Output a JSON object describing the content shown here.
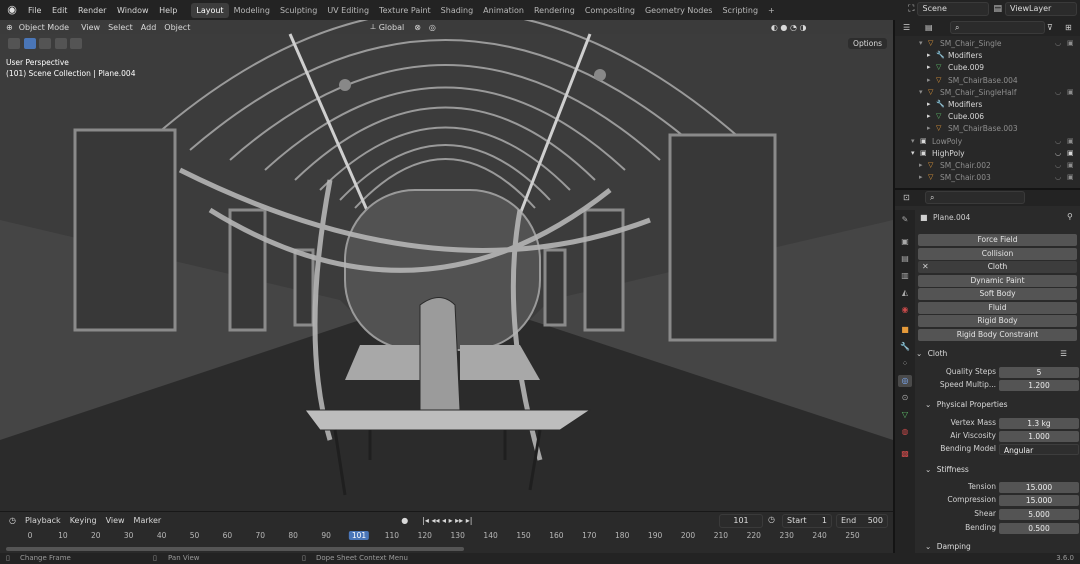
{
  "topbar": {
    "menus": [
      "File",
      "Edit",
      "Render",
      "Window",
      "Help"
    ],
    "workspaces": [
      "Layout",
      "Modeling",
      "Sculpting",
      "UV Editing",
      "Texture Paint",
      "Shading",
      "Animation",
      "Rendering",
      "Compositing",
      "Geometry Nodes",
      "Scripting"
    ],
    "active_workspace": "Layout",
    "add_tab": "+",
    "scene": "Scene",
    "view_layer": "ViewLayer"
  },
  "viewport": {
    "mode": "Object Mode",
    "menus": [
      "View",
      "Select",
      "Add",
      "Object"
    ],
    "orientation": "Global",
    "options": "Options",
    "perspective": "User Perspective",
    "collection": "(101) Scene Collection | Plane.004"
  },
  "timeline": {
    "menus": [
      "Playback",
      "Keying",
      "View",
      "Marker"
    ],
    "current_frame": "101",
    "start_label": "Start",
    "start": "1",
    "end_label": "End",
    "end": "500",
    "ticks": [
      "0",
      "10",
      "20",
      "30",
      "40",
      "50",
      "60",
      "70",
      "80",
      "90",
      "101",
      "110",
      "120",
      "130",
      "140",
      "150",
      "160",
      "170",
      "180",
      "190",
      "200",
      "210",
      "220",
      "230",
      "240",
      "250"
    ]
  },
  "statusbar": {
    "change_frame": "Change Frame",
    "pan_view": "Pan View",
    "context_menu": "Dope Sheet Context Menu",
    "version": "3.6.0"
  },
  "outliner": {
    "rows": [
      {
        "label": "SM_Chair_Single",
        "dim": true,
        "indent": 2
      },
      {
        "label": "Modifiers",
        "dim": false,
        "indent": 3
      },
      {
        "label": "Cube.009",
        "dim": false,
        "indent": 3
      },
      {
        "label": "SM_ChairBase.004",
        "dim": true,
        "indent": 3
      },
      {
        "label": "SM_Chair_SingleHalf",
        "dim": true,
        "indent": 2
      },
      {
        "label": "Modifiers",
        "dim": false,
        "indent": 3
      },
      {
        "label": "Cube.006",
        "dim": false,
        "indent": 3
      },
      {
        "label": "SM_ChairBase.003",
        "dim": true,
        "indent": 3
      },
      {
        "label": "LowPoly",
        "dim": true,
        "indent": 1
      },
      {
        "label": "HighPoly",
        "dim": false,
        "indent": 1
      },
      {
        "label": "SM_Chair.002",
        "dim": true,
        "indent": 2
      },
      {
        "label": "SM_Chair.003",
        "dim": true,
        "indent": 2
      }
    ]
  },
  "properties": {
    "object": "Plane.004",
    "physics_buttons": [
      "Force Field",
      "Collision",
      "Cloth",
      "Dynamic Paint",
      "Soft Body",
      "Fluid",
      "Rigid Body",
      "Rigid Body Constraint"
    ],
    "cloth_header": "Cloth",
    "quality_label": "Quality Steps",
    "quality": "5",
    "speed_label": "Speed Multip...",
    "speed": "1.200",
    "physical_header": "Physical Properties",
    "mass_label": "Vertex Mass",
    "mass": "1.3 kg",
    "air_label": "Air Viscosity",
    "air": "1.000",
    "bending_model_label": "Bending Model",
    "bending_model": "Angular",
    "stiffness_header": "Stiffness",
    "tension_label": "Tension",
    "tension": "15.000",
    "compression_label": "Compression",
    "compression": "15.000",
    "shear_label": "Shear",
    "shear": "5.000",
    "bending_label": "Bending",
    "bending": "0.500",
    "damping_header": "Damping"
  },
  "colors": {
    "accent": "#4a76b8",
    "panel": "#2a2a2a",
    "viewport": "#3b3b3b"
  }
}
